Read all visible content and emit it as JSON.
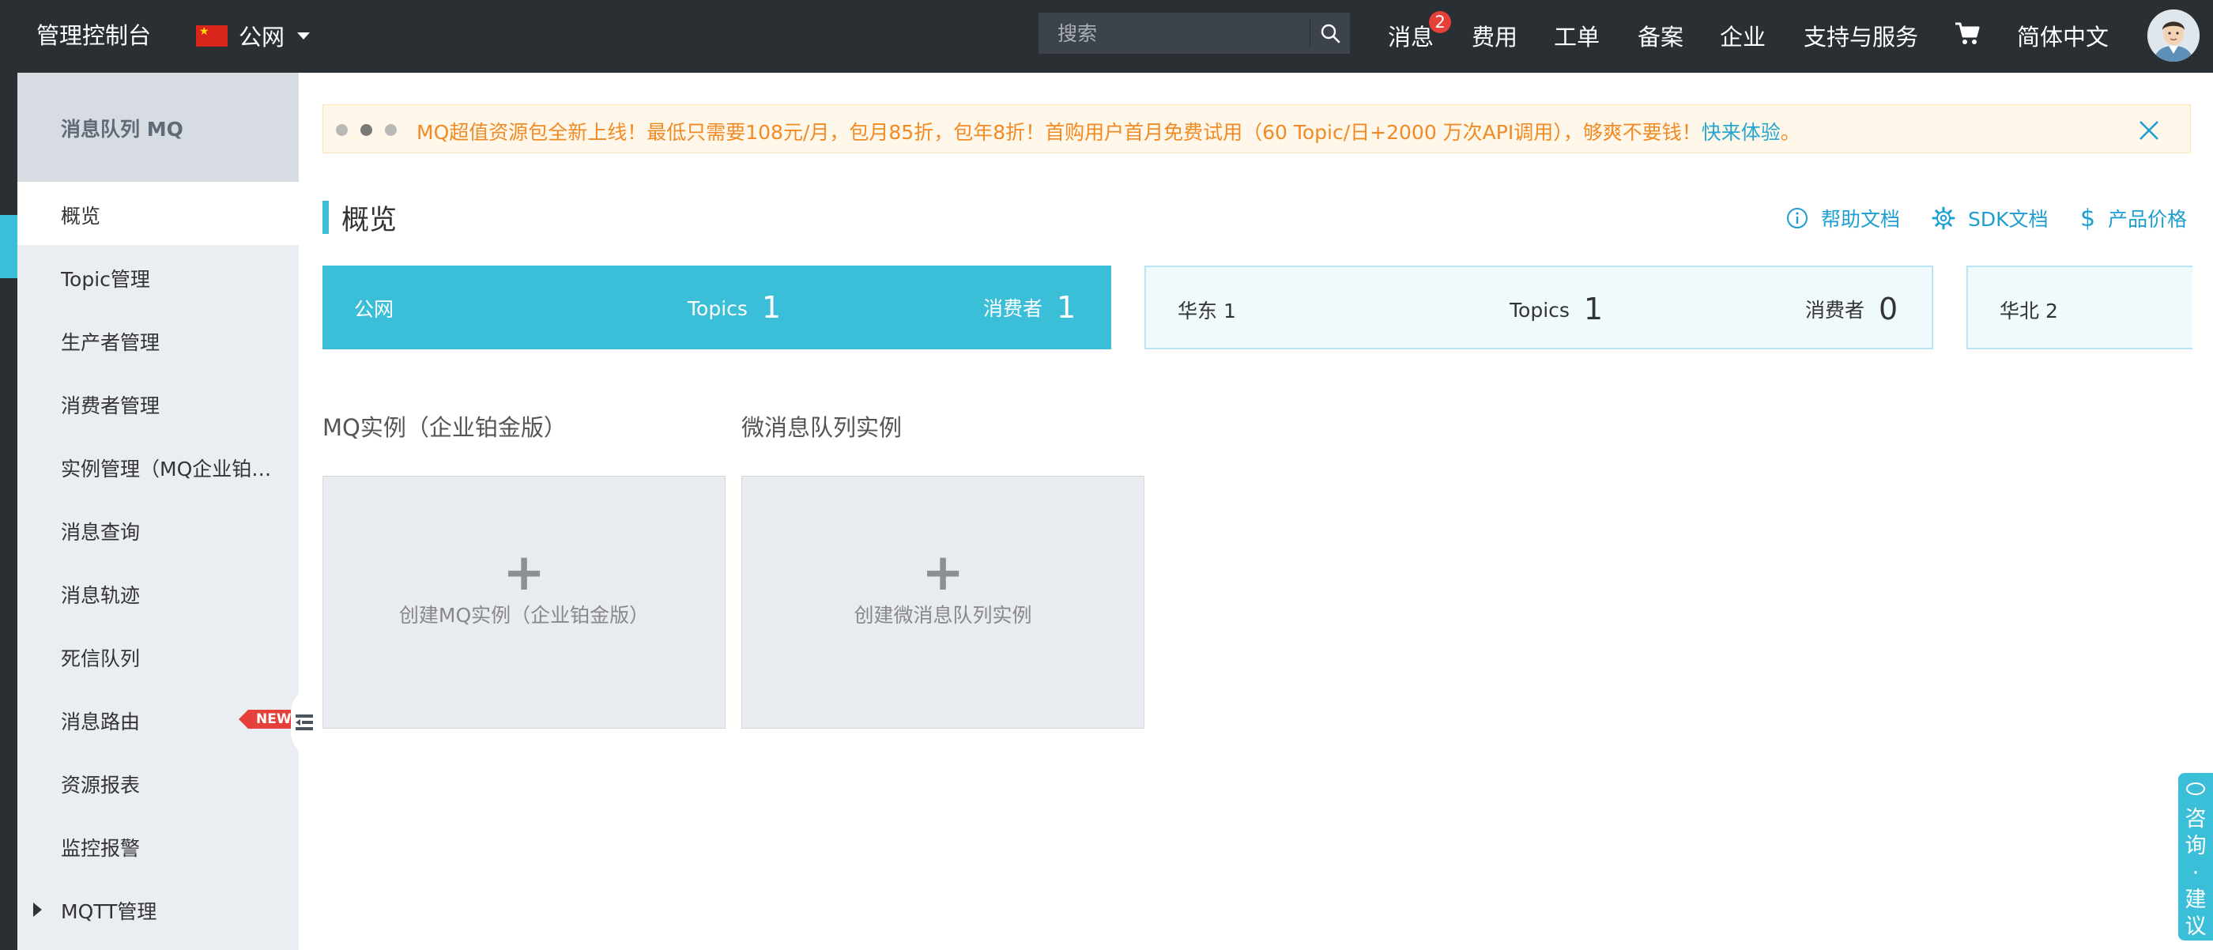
{
  "topbar": {
    "brand": "管理控制台",
    "region": "公网",
    "search_placeholder": "搜索",
    "nav": {
      "messages": "消息",
      "messages_badge": "2",
      "fees": "费用",
      "tickets": "工单",
      "filing": "备案",
      "enterprise": "企业",
      "support": "支持与服务",
      "language": "简体中文"
    }
  },
  "sidebar": {
    "title": "消息队列 MQ",
    "items": [
      {
        "label": "概览"
      },
      {
        "label": "Topic管理"
      },
      {
        "label": "生产者管理"
      },
      {
        "label": "消费者管理"
      },
      {
        "label": "实例管理（MQ企业铂…"
      },
      {
        "label": "消息查询"
      },
      {
        "label": "消息轨迹"
      },
      {
        "label": "死信队列"
      },
      {
        "label": "消息路由"
      },
      {
        "label": "资源报表"
      },
      {
        "label": "监控报警"
      },
      {
        "label": "MQTT管理"
      }
    ],
    "new_tag": "NEW"
  },
  "notice": {
    "message": "MQ超值资源包全新上线！最低只需要108元/月，包月85折，包年8折！首购用户首月免费试用（60 Topic/日+2000 万次API调用），够爽不要钱！",
    "link": "快来体验",
    "tail": "。"
  },
  "page": {
    "title": "概览",
    "links": {
      "help": "帮助文档",
      "sdk": "SDK文档",
      "price": "产品价格"
    }
  },
  "regions": [
    {
      "name": "公网",
      "topics_label": "Topics",
      "topics": "1",
      "consumers_label": "消费者",
      "consumers": "1"
    },
    {
      "name": "华东 1",
      "topics_label": "Topics",
      "topics": "1",
      "consumers_label": "消费者",
      "consumers": "0"
    },
    {
      "name": "华北 2"
    }
  ],
  "instances": {
    "mq_title": "MQ实例（企业铂金版）",
    "micro_title": "微消息队列实例",
    "mq_create": "创建MQ实例（企业铂金版）",
    "micro_create": "创建微消息队列实例"
  },
  "consult": {
    "label": "咨询·建议"
  },
  "colors": {
    "topbar": "#2a2f34",
    "accent": "#3bbfd8",
    "notice_text": "#f08a24",
    "link": "#1e9ed1",
    "badge": "#e5403a"
  }
}
